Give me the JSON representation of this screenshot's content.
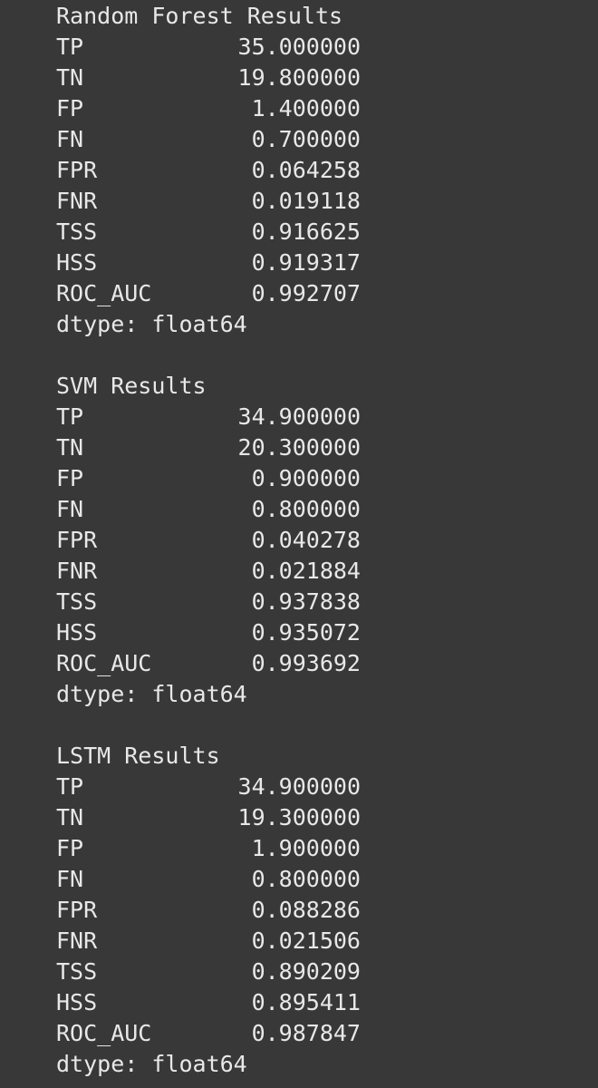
{
  "sections": [
    {
      "title": "Random Forest Results",
      "rows": [
        {
          "label": "TP",
          "value": "35.000000"
        },
        {
          "label": "TN",
          "value": "19.800000"
        },
        {
          "label": "FP",
          "value": "1.400000"
        },
        {
          "label": "FN",
          "value": "0.700000"
        },
        {
          "label": "FPR",
          "value": "0.064258"
        },
        {
          "label": "FNR",
          "value": "0.019118"
        },
        {
          "label": "TSS",
          "value": "0.916625"
        },
        {
          "label": "HSS",
          "value": "0.919317"
        },
        {
          "label": "ROC_AUC",
          "value": "0.992707"
        }
      ],
      "dtype": "dtype: float64"
    },
    {
      "title": "SVM Results",
      "rows": [
        {
          "label": "TP",
          "value": "34.900000"
        },
        {
          "label": "TN",
          "value": "20.300000"
        },
        {
          "label": "FP",
          "value": "0.900000"
        },
        {
          "label": "FN",
          "value": "0.800000"
        },
        {
          "label": "FPR",
          "value": "0.040278"
        },
        {
          "label": "FNR",
          "value": "0.021884"
        },
        {
          "label": "TSS",
          "value": "0.937838"
        },
        {
          "label": "HSS",
          "value": "0.935072"
        },
        {
          "label": "ROC_AUC",
          "value": "0.993692"
        }
      ],
      "dtype": "dtype: float64"
    },
    {
      "title": "LSTM Results",
      "rows": [
        {
          "label": "TP",
          "value": "34.900000"
        },
        {
          "label": "TN",
          "value": "19.300000"
        },
        {
          "label": "FP",
          "value": "1.900000"
        },
        {
          "label": "FN",
          "value": "0.800000"
        },
        {
          "label": "FPR",
          "value": "0.088286"
        },
        {
          "label": "FNR",
          "value": "0.021506"
        },
        {
          "label": "TSS",
          "value": "0.890209"
        },
        {
          "label": "HSS",
          "value": "0.895411"
        },
        {
          "label": "ROC_AUC",
          "value": "0.987847"
        }
      ],
      "dtype": "dtype: float64"
    }
  ]
}
